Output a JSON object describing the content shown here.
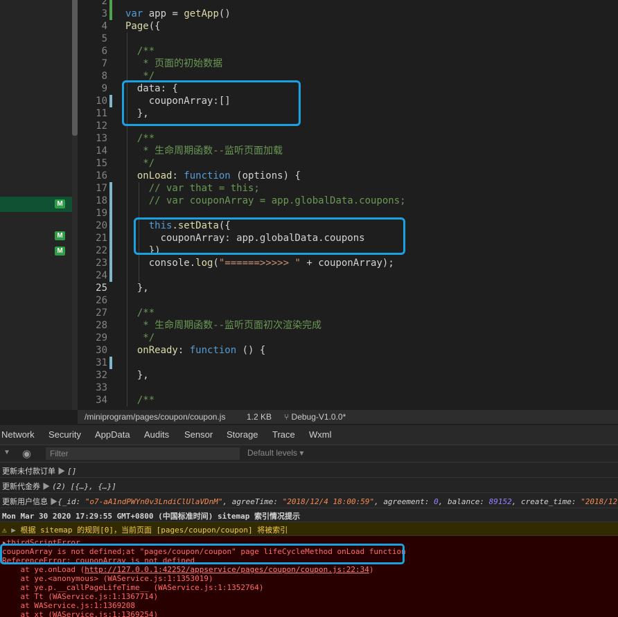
{
  "explorer": {
    "badges": [
      "M",
      "M",
      "M"
    ]
  },
  "editor": {
    "lines": [
      {
        "n": "2",
        "html": ""
      },
      {
        "n": "3",
        "html": "<span class='kw'>var</span> app = <span class='fn'>getApp</span>()"
      },
      {
        "n": "4",
        "html": "<span class='fn'>Page</span>({"
      },
      {
        "n": "5",
        "html": ""
      },
      {
        "n": "6",
        "html": "  <span class='cm'>/**</span>"
      },
      {
        "n": "7",
        "html": "  <span class='cm'> * 页面的初始数据</span>"
      },
      {
        "n": "8",
        "html": "  <span class='cm'> */</span>"
      },
      {
        "n": "9",
        "html": "  data: {"
      },
      {
        "n": "10",
        "html": "    couponArray:[]"
      },
      {
        "n": "11",
        "html": "  },"
      },
      {
        "n": "12",
        "html": ""
      },
      {
        "n": "13",
        "html": "  <span class='cm'>/**</span>"
      },
      {
        "n": "14",
        "html": "  <span class='cm'> * 生命周期函数--监听页面加载</span>"
      },
      {
        "n": "15",
        "html": "  <span class='cm'> */</span>"
      },
      {
        "n": "16",
        "html": "  <span class='fn'>onLoad</span>: <span class='kw'>function</span> (options) {"
      },
      {
        "n": "17",
        "html": "    <span class='cm'>// var that = this;</span>"
      },
      {
        "n": "18",
        "html": "    <span class='cm'>// var couponArray = app.globalData.coupons;</span>"
      },
      {
        "n": "19",
        "html": ""
      },
      {
        "n": "20",
        "html": "    <span class='kw'>this</span>.<span class='fn'>setData</span>({"
      },
      {
        "n": "21",
        "html": "      couponArray: app.globalData.coupons"
      },
      {
        "n": "22",
        "html": "    })"
      },
      {
        "n": "23",
        "html": "    console.<span class='fn'>log</span>(<span class='str'>\"======>>>>> \"</span> + couponArray);"
      },
      {
        "n": "24",
        "html": ""
      },
      {
        "n": "25",
        "html": "  },"
      },
      {
        "n": "26",
        "html": ""
      },
      {
        "n": "27",
        "html": "  <span class='cm'>/**</span>"
      },
      {
        "n": "28",
        "html": "  <span class='cm'> * 生命周期函数--监听页面初次渲染完成</span>"
      },
      {
        "n": "29",
        "html": "  <span class='cm'> */</span>"
      },
      {
        "n": "30",
        "html": "  <span class='fn'>onReady</span>: <span class='kw'>function</span> () {"
      },
      {
        "n": "31",
        "html": ""
      },
      {
        "n": "32",
        "html": "  },"
      },
      {
        "n": "33",
        "html": ""
      },
      {
        "n": "34",
        "html": "  <span class='cm'>/**</span>"
      }
    ]
  },
  "status": {
    "path": "/miniprogram/pages/coupon/coupon.js",
    "size": "1.2 KB",
    "branch": "Debug-V1.0.0*"
  },
  "devtools": {
    "tabs": [
      "Network",
      "Security",
      "AppData",
      "Audits",
      "Sensor",
      "Storage",
      "Trace",
      "Wxml"
    ],
    "filter_placeholder": "Filter",
    "levels": "Default levels ▾"
  },
  "console": {
    "l1_label": "更新未付款订单",
    "l1_value": "[]",
    "l2_label": "更新代金券",
    "l2_value": "(2) [{…}, {…}]",
    "l3_label": "更新用户信息",
    "l3_id_key": "_id",
    "l3_id_val": "\"o7-aA1ndPWYn0v3LndiClUlaVDnM\"",
    "l3_agree_key": "agreeTime",
    "l3_agree_val": "\"2018/12/4 18:00:59\"",
    "l3_agreement_key": "agreement",
    "l3_agreement_val": "0",
    "l3_balance_key": "balance",
    "l3_balance_val": "89152",
    "l3_create_key": "create_time",
    "l3_create_val": "\"2018/12",
    "timestamp": "Mon Mar 30 2020 17:29:55 GMT+0800 (中国标准时间) sitemap 索引情况提示",
    "warning": "根据 sitemap 的规则[0]，当前页面 [pages/coupon/coupon] 将被索引",
    "error_head": "thirdScriptError",
    "error_1": "couponArray is not defined;at \"pages/coupon/coupon\" page lifeCycleMethod onLoad function",
    "error_2": "ReferenceError: couponArray is not defined",
    "stack_1_prefix": "    at ye.onLoad (",
    "stack_1_link": "http://127.0.0.1:42252/appservice/pages/coupon/coupon.js:22:34",
    "stack_1_suffix": ")",
    "stack_2": "    at ye.<anonymous> (WAService.js:1:1353019)",
    "stack_3": "    at ye.p.__callPageLifeTime__ (WAService.js:1:1352764)",
    "stack_4": "    at Tt (WAService.js:1:1367714)",
    "stack_5": "    at WAService.js:1:1369208",
    "stack_6": "    at xt (WAService.js:1:1369254)"
  }
}
